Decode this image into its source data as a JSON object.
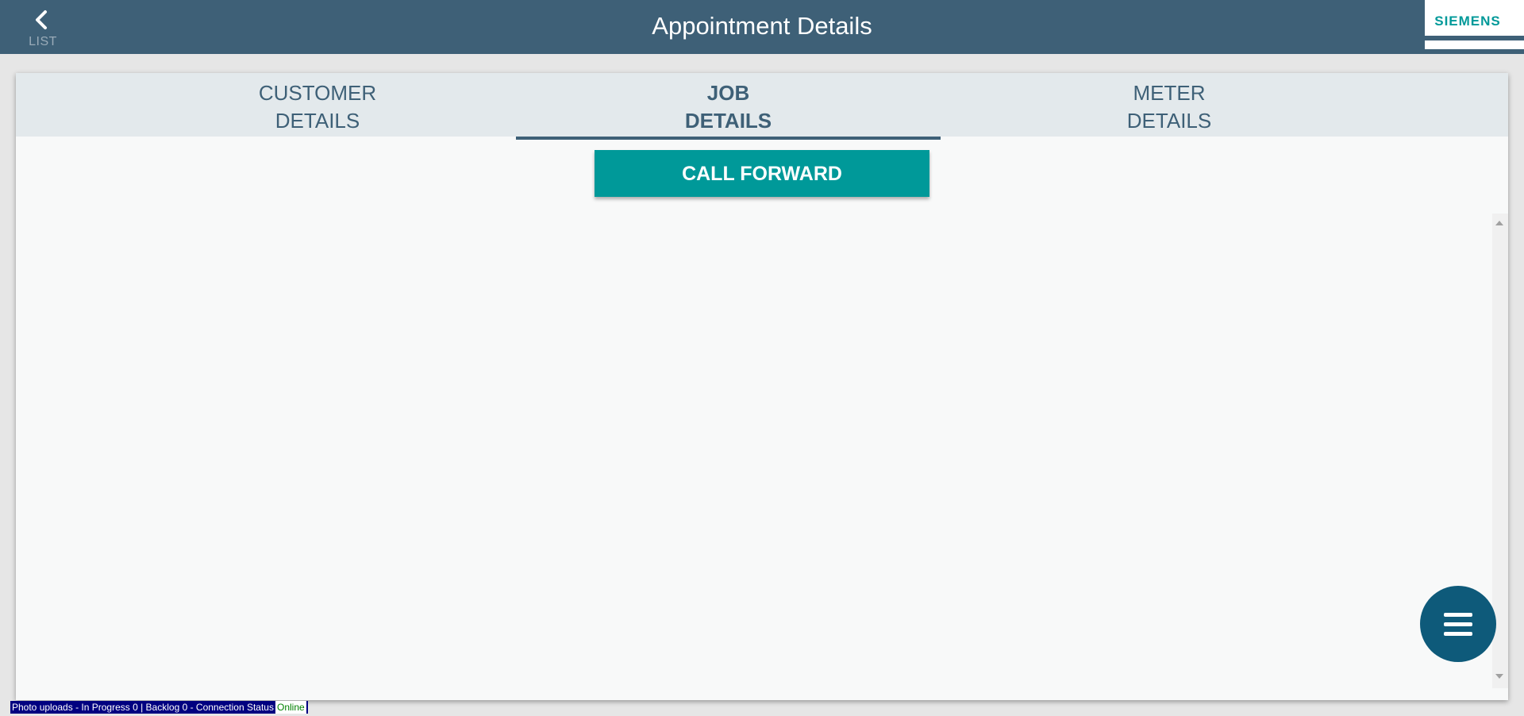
{
  "header": {
    "back_label": "LIST",
    "title": "Appointment Details",
    "logo_text": "SIEMENS",
    "back_icon": "chevron-left-icon"
  },
  "tabs": [
    {
      "line1": "CUSTOMER",
      "line2": "DETAILS",
      "active": false
    },
    {
      "line1": "JOB",
      "line2": "DETAILS",
      "active": true
    },
    {
      "line1": "METER",
      "line2": "DETAILS",
      "active": false
    }
  ],
  "main": {
    "call_forward_label": "CALL FORWARD"
  },
  "fab": {
    "icon": "menu-icon"
  },
  "status": {
    "text": "Photo uploads - In Progress 0 | Backlog 0 - Connection Status",
    "connection": "Online"
  },
  "colors": {
    "header_bg": "#3e6077",
    "accent_teal": "#009999",
    "fab_bg": "#0e5a7a",
    "tabbar_bg": "#e3e9ec",
    "status_bg": "#000080",
    "online_text": "#008000"
  }
}
